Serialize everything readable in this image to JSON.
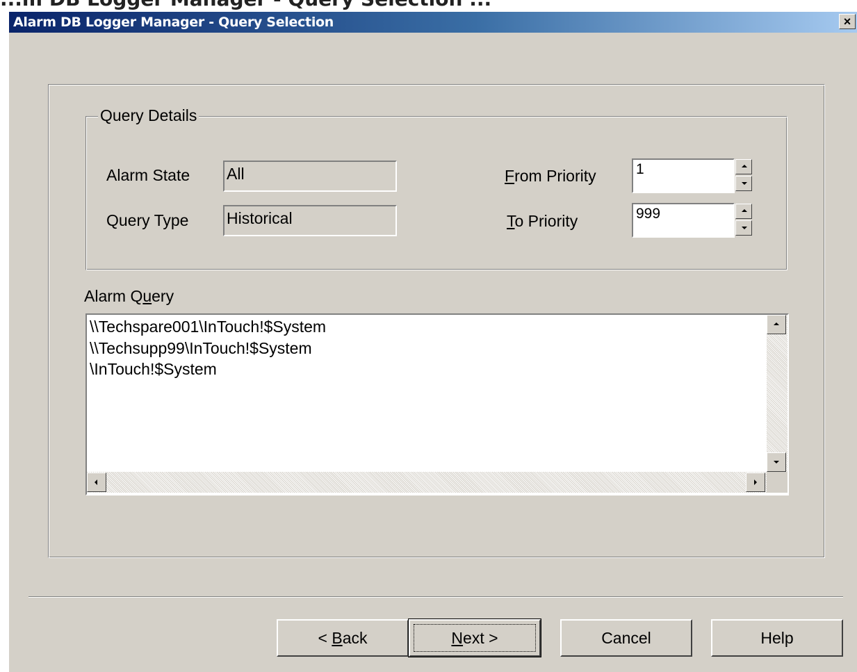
{
  "background_text": "...m DB Logger Manager - Query Selection ...",
  "window": {
    "title": "Alarm DB Logger Manager - Query Selection",
    "close_glyph": "×"
  },
  "query_details": {
    "group_label": "Query Details",
    "alarm_state_label": "Alarm State",
    "alarm_state_value": "All",
    "query_type_label": "Query Type",
    "query_type_value": "Historical",
    "from_priority_label_mnemonic": "F",
    "from_priority_label_rest": "rom Priority",
    "from_priority_value": "1",
    "to_priority_label_mnemonic": "T",
    "to_priority_label_rest": "o Priority",
    "to_priority_value": "999"
  },
  "alarm_query": {
    "label_prefix": "Alarm Q",
    "label_mnemonic": "u",
    "label_suffix": "ery",
    "lines": [
      "\\\\Techspare001\\InTouch!$System",
      "\\\\Techsupp99\\InTouch!$System",
      "\\InTouch!$System"
    ]
  },
  "buttons": {
    "back_prefix": "< ",
    "back_mnemonic": "B",
    "back_rest": "ack",
    "next_mnemonic": "N",
    "next_rest": "ext",
    "next_suffix": " >",
    "cancel": "Cancel",
    "help": "Help"
  }
}
